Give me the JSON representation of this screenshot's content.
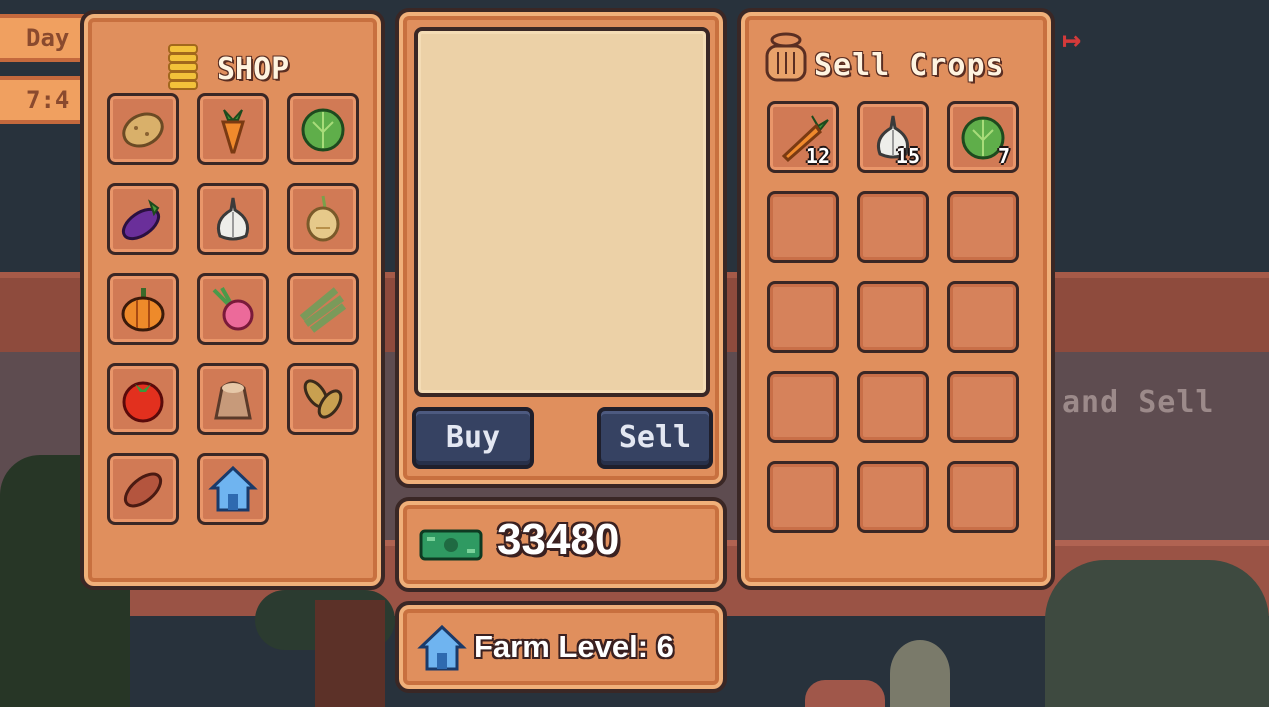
{
  "hud": {
    "day_label": "Day",
    "time_label": "7:4"
  },
  "shop": {
    "title": "SHOP",
    "items": [
      {
        "name": "potato"
      },
      {
        "name": "carrot"
      },
      {
        "name": "cabbage"
      },
      {
        "name": "eggplant"
      },
      {
        "name": "garlic"
      },
      {
        "name": "onion"
      },
      {
        "name": "pumpkin"
      },
      {
        "name": "radish"
      },
      {
        "name": "wheat"
      },
      {
        "name": "tomato"
      },
      {
        "name": "seed-bag"
      },
      {
        "name": "peanut"
      },
      {
        "name": "sweet-potato"
      },
      {
        "name": "farm-upgrade"
      }
    ]
  },
  "actions": {
    "buy_label": "Buy",
    "sell_label": "Sell"
  },
  "money": {
    "value": "33480"
  },
  "farm": {
    "level_label": "Farm Level: 6"
  },
  "sell": {
    "title": "Sell Crops",
    "items": [
      {
        "name": "carrot",
        "count": "12"
      },
      {
        "name": "garlic",
        "count": "15"
      },
      {
        "name": "cabbage",
        "count": "7"
      }
    ]
  },
  "background": {
    "sign_text": "and Sell"
  },
  "colors": {
    "panel": "#e08f5d",
    "button": "#364262",
    "money_green": "#2f9a62"
  }
}
